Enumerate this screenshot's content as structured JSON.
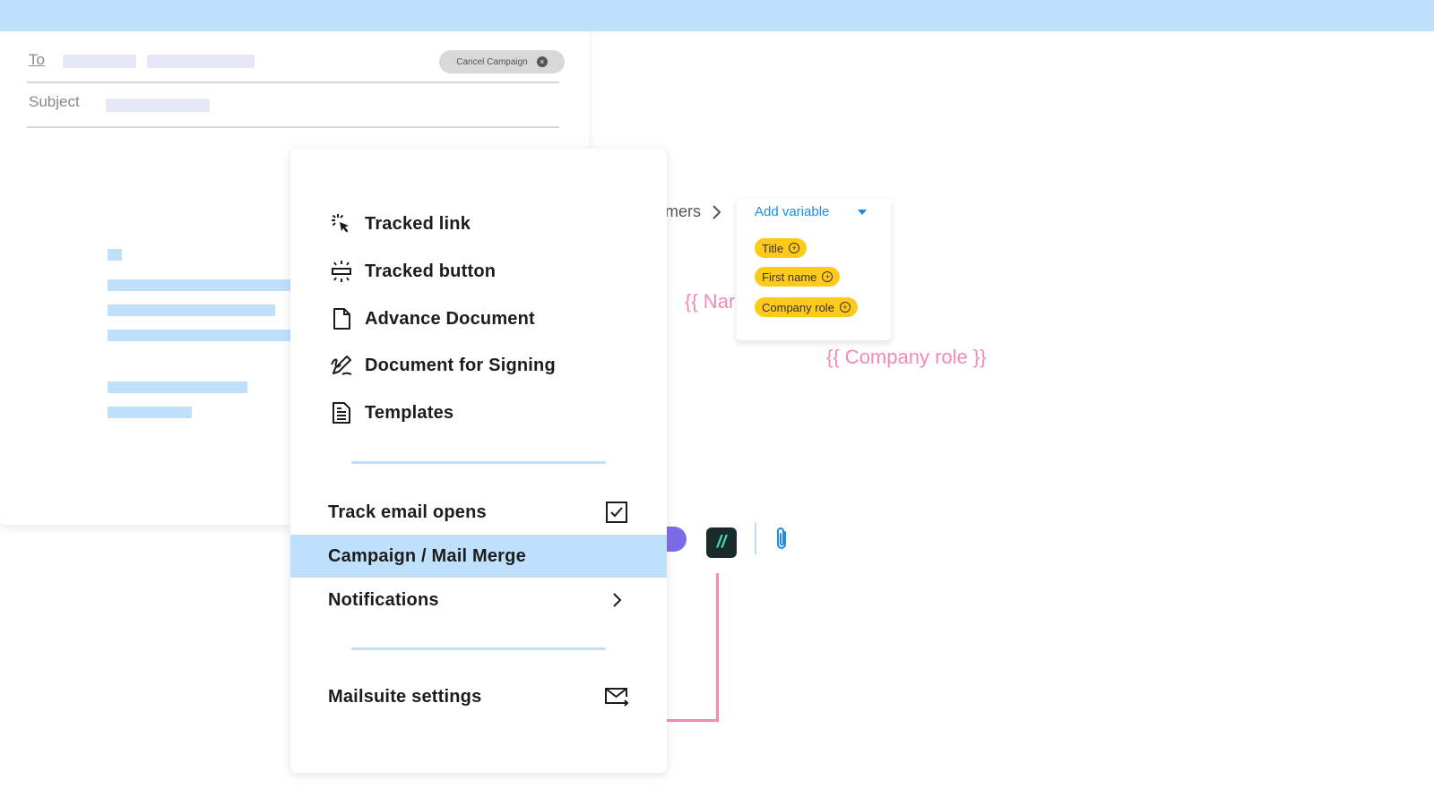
{
  "compose": {
    "to_label": "To",
    "subject_label": "Subject",
    "cancel_label": "Cancel Campaign",
    "breadcrumb_tail": "mers",
    "add_variable_label": "Add variable",
    "variables": [
      "Title",
      "First name",
      "Company role"
    ],
    "body_var_name": "{{ Nar",
    "body_var_role": "{{ Company role }}",
    "brand_glyph": "//"
  },
  "menu": {
    "items": [
      {
        "label": "Tracked link",
        "icon": "cursor-click-icon"
      },
      {
        "label": "Tracked button",
        "icon": "tracked-button-icon"
      },
      {
        "label": "Advance Document",
        "icon": "document-icon"
      },
      {
        "label": "Document for Signing",
        "icon": "signature-icon"
      },
      {
        "label": "Templates",
        "icon": "template-icon"
      }
    ],
    "track_opens_label": "Track email opens",
    "campaign_label": "Campaign / Mail Merge",
    "notifications_label": "Notifications",
    "settings_label": "Mailsuite settings"
  },
  "colors": {
    "accent_light_blue": "#bfe0fb",
    "variable_pink": "#f08ab8",
    "chip_yellow": "#ffca1a",
    "link_blue": "#1a8ee0"
  }
}
